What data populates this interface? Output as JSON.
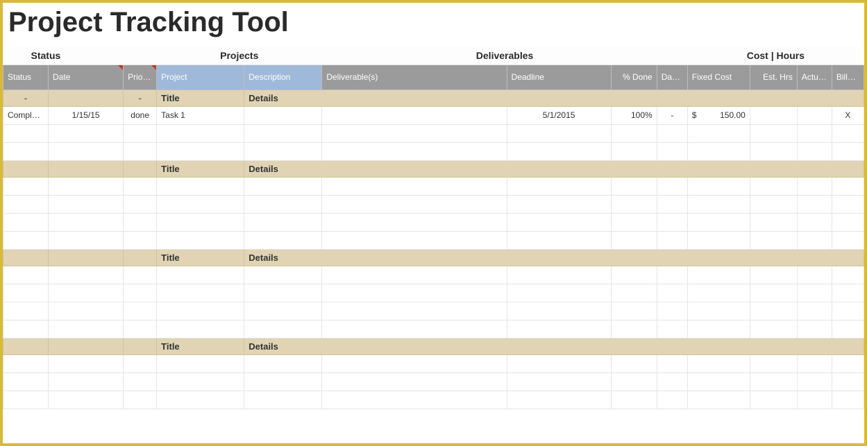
{
  "title": "Project Tracking Tool",
  "sections": {
    "status": "Status",
    "projects": "Projects",
    "deliverables": "Deliverables",
    "cost_hours": "Cost | Hours"
  },
  "columns": {
    "status": "Status",
    "date": "Date",
    "priority": "Priority",
    "project": "Project",
    "description": "Description",
    "deliverables": "Deliverable(s)",
    "deadline": "Deadline",
    "pct_done": "% Done",
    "days_left": "Days Left",
    "fixed_cost": "Fixed Cost",
    "est_hrs": "Est. Hrs",
    "actual_hrs": "Actual Hrs",
    "billed_hrs": "Billed Hrs"
  },
  "group_labels": {
    "title": "Title",
    "details": "Details"
  },
  "summary_row": {
    "status": "-",
    "priority": "-"
  },
  "rows": [
    {
      "status": "Completed",
      "date": "1/15/15",
      "priority": "done",
      "project": "Task 1",
      "description": "",
      "deliverables": "",
      "deadline": "5/1/2015",
      "pct_done": "100%",
      "days_left": "-",
      "fixed_cost_currency": "$",
      "fixed_cost_value": "150.00",
      "est_hrs": "",
      "actual_hrs": "",
      "billed_hrs": "X"
    }
  ]
}
